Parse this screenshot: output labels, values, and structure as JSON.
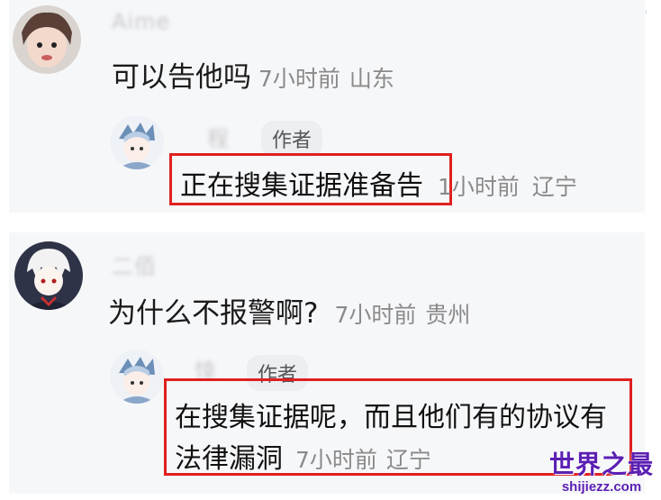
{
  "comments": [
    {
      "username": "Aime",
      "text": "可以告他吗",
      "time": "7小时前",
      "location": "山东",
      "reply": {
        "username": "程",
        "badge": "作者",
        "text": "正在搜集证据准备告",
        "time": "1小时前",
        "location": "辽宁"
      }
    },
    {
      "username": "二佰",
      "text": "为什么不报警啊?",
      "time": "7小时前",
      "location": "贵州",
      "reply": {
        "username": "悻",
        "badge": "作者",
        "text_line1": "在搜集证据呢，而且他们有的协议有",
        "text_line2": "法律漏洞",
        "time": "7小时前",
        "location": "辽宁"
      }
    }
  ],
  "watermark": {
    "title": "世界之最",
    "url": "shijiezz.com"
  },
  "colors": {
    "highlight": "#e02020",
    "watermark": "#5b1fb3"
  }
}
